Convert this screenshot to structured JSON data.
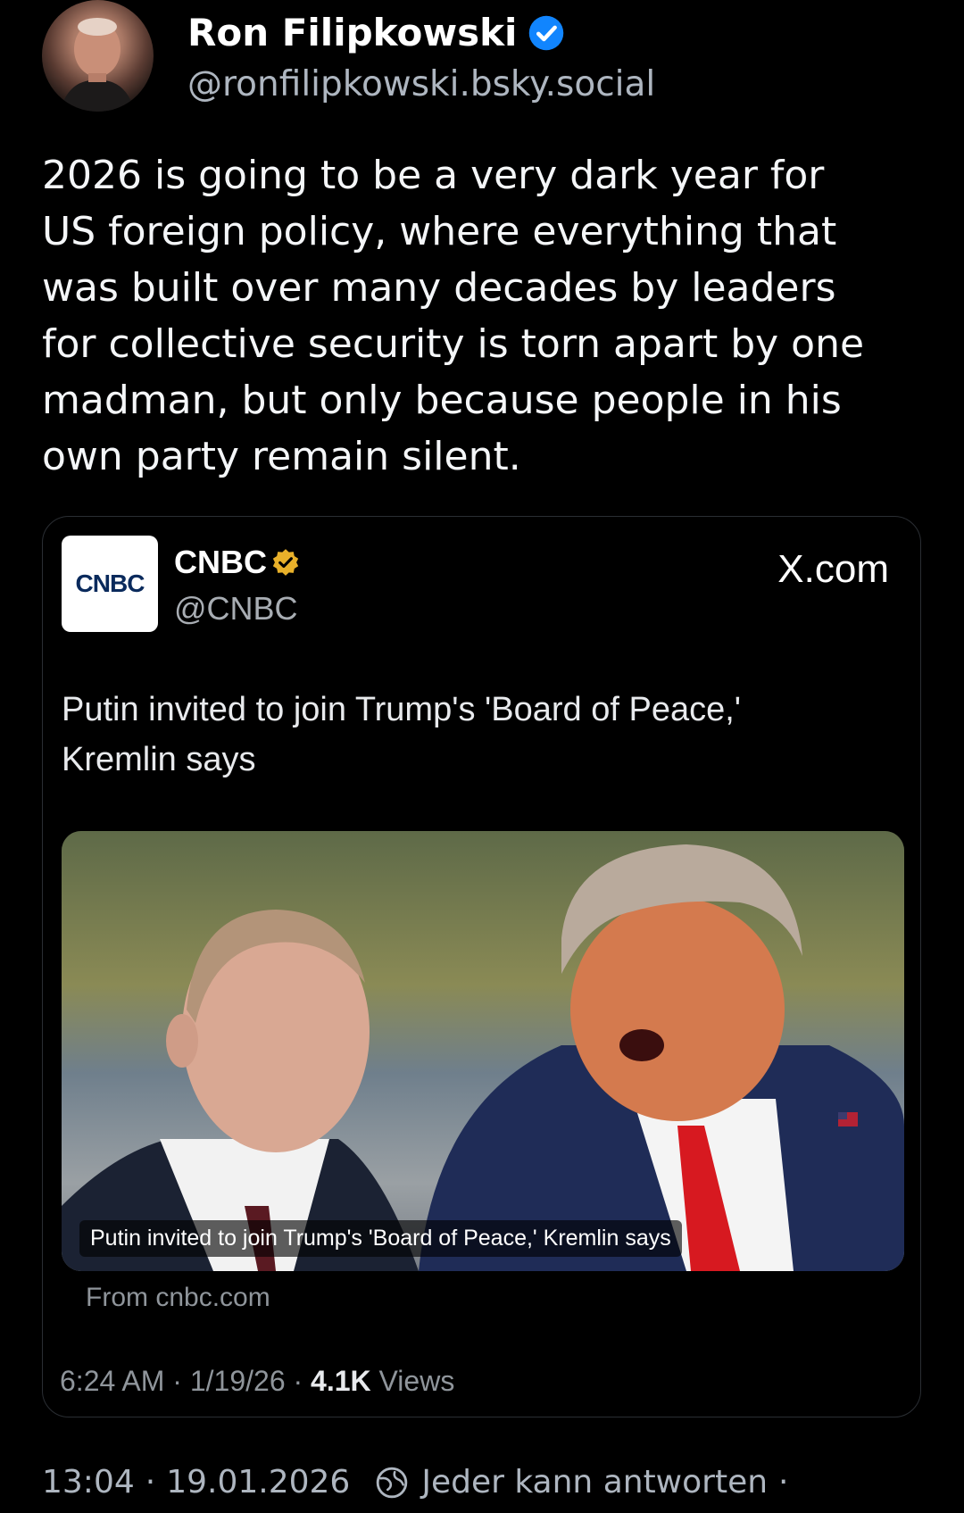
{
  "post": {
    "author_name": "Ron Filipkowski",
    "author_handle": "@ronfilipkowski.bsky.social",
    "text": "2026 is going to be a very dark year for\nUS foreign policy, where everything that\nwas built over many decades by leaders\nfor collective security is torn apart by one\nmadman, but only because people in his\nown party remain silent.",
    "time": "13:04",
    "date": "19.01.2026",
    "reply_setting": "Jeder kann antworten",
    "trailing_dot": "·"
  },
  "embed": {
    "account_logo_text": "CNBC",
    "account_name": "CNBC",
    "account_handle": "@CNBC",
    "source_site": "X.com",
    "headline": "Putin invited to join Trump's 'Board of Peace,'\nKremlin says",
    "image_caption": "Putin invited to join Trump's 'Board of Peace,' Kremlin says",
    "from_text": "From cnbc.com",
    "time": "6:24 AM",
    "date": "1/19/26",
    "views_count": "4.1K",
    "views_label": "Views"
  },
  "icons": {
    "verified": "verified-check-icon",
    "gold_verified": "gold-verified-icon",
    "reply": "reply-setting-icon"
  },
  "colors": {
    "background": "#000000",
    "verified_blue": "#1185fe",
    "gold_badge": "#e8b02a",
    "tie_red": "#d71920"
  }
}
